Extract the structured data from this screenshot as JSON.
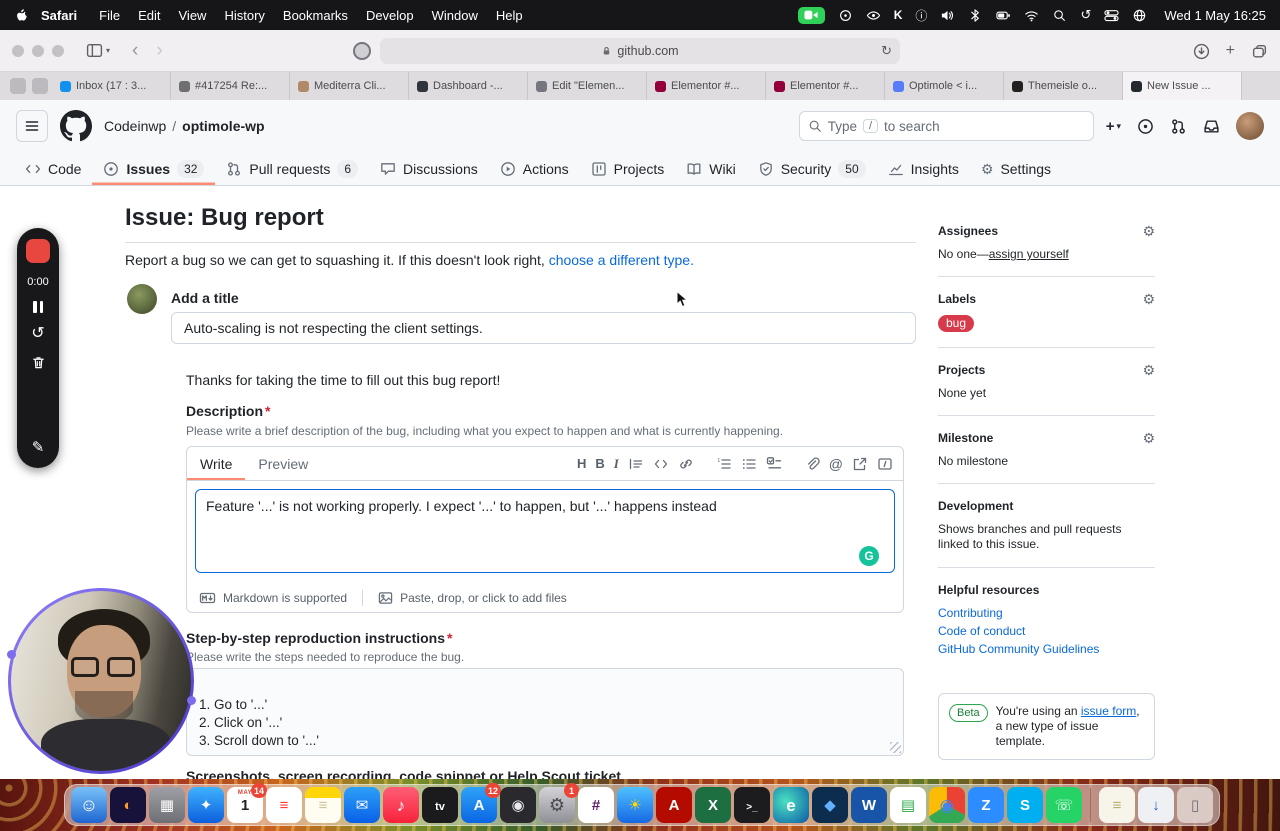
{
  "icons": {
    "gear": "⚙",
    "reload": "↻",
    "restart": "↺",
    "pen": "✎",
    "back": "‹",
    "forward": "›",
    "plus": "+",
    "caret": "▾",
    "mention": "@",
    "heading": "H",
    "bold": "B",
    "italic": "I",
    "grammarly": "G",
    "keyboard_k": "K",
    "info": "ⓘ",
    "time_machine": "↺",
    "chevron_down": "▾"
  },
  "menubar": {
    "app_name": "Safari",
    "items": [
      "File",
      "Edit",
      "View",
      "History",
      "Bookmarks",
      "Develop",
      "Window",
      "Help"
    ],
    "clock": "Wed 1 May  16:25"
  },
  "browser": {
    "address": "github.com",
    "tabs": [
      {
        "label": "Inbox (17 : 3...",
        "fav": "#1292ee"
      },
      {
        "label": "#417254 Re:...",
        "fav": "#6e6e73"
      },
      {
        "label": "Mediterra Cli...",
        "fav": "#b08968"
      },
      {
        "label": "Dashboard -...",
        "fav": "#30343c"
      },
      {
        "label": "Edit \"Elemen...",
        "fav": "#767680"
      },
      {
        "label": "Elementor #...",
        "fav": "#92003b"
      },
      {
        "label": "Elementor #...",
        "fav": "#92003b"
      },
      {
        "label": "Optimole < i...",
        "fav": "#577bf9"
      },
      {
        "label": "Themeisle o...",
        "fav": "#23211f"
      },
      {
        "label": "New Issue ...",
        "fav": "#24292f",
        "active": "active"
      }
    ]
  },
  "github": {
    "header": {
      "org": "Codeinwp",
      "slash": "/",
      "repo": "optimole-wp",
      "search_prefix": "Type",
      "search_slash": "/",
      "search_suffix": "to search"
    },
    "nav": [
      {
        "label": "Code"
      },
      {
        "label": "Issues",
        "count": "32"
      },
      {
        "label": "Pull requests",
        "count": "6"
      },
      {
        "label": "Discussions"
      },
      {
        "label": "Actions"
      },
      {
        "label": "Projects"
      },
      {
        "label": "Wiki"
      },
      {
        "label": "Security",
        "count": "50"
      },
      {
        "label": "Insights"
      },
      {
        "label": "Settings"
      }
    ],
    "form": {
      "title": "Issue: Bug report",
      "intro_text": "Report a bug so we can get to squashing it. If this doesn't look right,",
      "intro_link": "choose a different type.",
      "add_title_label": "Add a title",
      "title_value": "Auto-scaling is not respecting the client settings.",
      "thanks": "Thanks for taking the time to fill out this bug report!",
      "description": {
        "label": "Description",
        "required": "*",
        "hint": "Please write a brief description of the bug, including what you expect to happen and what is currently happening.",
        "write_tab": "Write",
        "preview_tab": "Preview",
        "value": "Feature '...' is not working properly. I expect '...' to happen, but '...' happens instead",
        "markdown_note": "Markdown is supported",
        "paste_note": "Paste, drop, or click to add files"
      },
      "steps": {
        "label": "Step-by-step reproduction instructions",
        "required": "*",
        "hint": "Please write the steps needed to reproduce the bug.",
        "value": "1. Go to '...'\n2. Click on '...'\n3. Scroll down to '...'"
      },
      "screenshots_label": "Screenshots, screen recording, code snippet or Help Scout ticket"
    },
    "sidebar": {
      "assignees_title": "Assignees",
      "assignees_text": "No one—",
      "assignees_link": "assign yourself",
      "labels_title": "Labels",
      "label_bug": "bug",
      "projects_title": "Projects",
      "projects_text": "None yet",
      "milestone_title": "Milestone",
      "milestone_text": "No milestone",
      "development_title": "Development",
      "development_text": "Shows branches and pull requests linked to this issue.",
      "resources_title": "Helpful resources",
      "resources_links": [
        "Contributing",
        "Code of conduct",
        "GitHub Community Guidelines"
      ],
      "beta_badge": "Beta",
      "beta_pre": "You're using an ",
      "beta_link": "issue form",
      "beta_post": ", a new type of issue template."
    }
  },
  "recorder": {
    "time": "0:00"
  },
  "dock": {
    "apps": [
      {
        "name": "finder",
        "bg": "linear-gradient(180deg,#79c1f7,#1e66d0)",
        "glyph": "☺",
        "color": "#ffffff",
        "fs": "18px"
      },
      {
        "name": "firefox",
        "bg": "#17123a",
        "glyph": "◐",
        "color": "#ff9b2e"
      },
      {
        "name": "launchpad",
        "bg": "linear-gradient(180deg,#9fa0a6,#6e6f75)",
        "glyph": "▦",
        "color": "#ffffff"
      },
      {
        "name": "safari",
        "bg": "linear-gradient(180deg,#3fb2ff,#0b5fdc)",
        "glyph": "✦",
        "color": "#ffffff"
      },
      {
        "name": "calendar",
        "bg": "#ffffff",
        "top": "MAY",
        "glyph": "1",
        "color": "#222222",
        "fs": "15px",
        "badge": "14"
      },
      {
        "name": "reminders",
        "bg": "#ffffff",
        "glyph": "≡",
        "color": "#ff3b30"
      },
      {
        "name": "notes",
        "bg": "linear-gradient(180deg,#ffd60a 30%,#fffdf2 30%)",
        "glyph": "≡",
        "color": "#c9c49a"
      },
      {
        "name": "mail",
        "bg": "linear-gradient(180deg,#2da0f8,#0a60e8)",
        "glyph": "✉",
        "color": "#ffffff"
      },
      {
        "name": "music",
        "bg": "linear-gradient(180deg,#fd5e76,#f8223b)",
        "glyph": "♪",
        "color": "#ffffff",
        "fs": "17px"
      },
      {
        "name": "apple-tv",
        "bg": "#1b1b1d",
        "glyph": "tv",
        "color": "#ffffff",
        "fs": "11px"
      },
      {
        "name": "app-store",
        "bg": "linear-gradient(180deg,#2fa3f7,#0b66e4)",
        "glyph": "A",
        "color": "#ffffff",
        "badge": "12"
      },
      {
        "name": "camera-app",
        "bg": "#2a2a2e",
        "glyph": "◉",
        "color": "#e8e8ef"
      },
      {
        "name": "system-settings",
        "bg": "linear-gradient(180deg,#d3d3d8,#8f8f96)",
        "glyph": "⚙",
        "color": "#4a4a50",
        "fs": "18px",
        "badge": "1"
      },
      {
        "name": "slack",
        "bg": "#ffffff",
        "glyph": "#",
        "color": "#611f69"
      },
      {
        "name": "weather",
        "bg": "linear-gradient(180deg,#4fc1ff,#1668e3)",
        "glyph": "☀",
        "color": "#ffd60a"
      },
      {
        "name": "acrobat",
        "bg": "#b30b00",
        "glyph": "A",
        "color": "#ffffff"
      },
      {
        "name": "excel",
        "bg": "#1d6f42",
        "glyph": "X",
        "color": "#ffffff"
      },
      {
        "name": "terminal",
        "bg": "#1c1c1e",
        "glyph": ">_",
        "color": "#ffffff",
        "fs": "10px"
      },
      {
        "name": "edge",
        "bg": "radial-gradient(circle at 35% 40%,#49e2c2,#0c59a4)",
        "glyph": "e",
        "color": "#ffffff",
        "fs": "17px"
      },
      {
        "name": "dev-app",
        "bg": "#0d2d4e",
        "glyph": "◆",
        "color": "#62b0ff"
      },
      {
        "name": "word",
        "bg": "#1855a8",
        "glyph": "W",
        "color": "#ffffff"
      },
      {
        "name": "numbers",
        "bg": "#ffffff",
        "glyph": "▤",
        "color": "#28a745"
      },
      {
        "name": "chrome",
        "bg": "conic-gradient(#ea4335 0 33%,#34a853 33% 66%,#fbbc05 66% 100%)",
        "glyph": "◉",
        "color": "#4285f4",
        "fs": "17px"
      },
      {
        "name": "zoom",
        "bg": "#2d8cff",
        "glyph": "Z",
        "color": "#ffffff"
      },
      {
        "name": "skype",
        "bg": "#00aff0",
        "glyph": "S",
        "color": "#ffffff"
      },
      {
        "name": "whatsapp",
        "bg": "#25d366",
        "glyph": "☏",
        "color": "#ffffff"
      }
    ],
    "tail": [
      {
        "name": "stickies",
        "bg": "#f7f4e9",
        "glyph": "≡",
        "color": "#b9ae6d"
      },
      {
        "name": "downloads",
        "bg": "#eef0f4",
        "glyph": "↓",
        "color": "#1e66d0"
      },
      {
        "name": "trash",
        "bg": "rgba(255,255,255,0.55)",
        "glyph": "▯",
        "color": "#6e6e73"
      }
    ]
  }
}
